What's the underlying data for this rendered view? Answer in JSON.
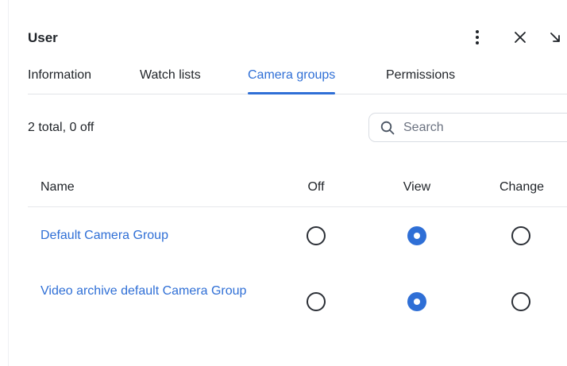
{
  "header": {
    "title": "User",
    "icons": [
      "more-vertical-icon",
      "close-icon",
      "collapse-arrow-icon"
    ]
  },
  "tabs": [
    {
      "label": "Information",
      "active": false
    },
    {
      "label": "Watch lists",
      "active": false
    },
    {
      "label": "Camera groups",
      "active": true
    },
    {
      "label": "Permissions",
      "active": false
    }
  ],
  "summary": "2 total, 0 off",
  "search": {
    "placeholder": "Search",
    "value": "",
    "icon": "search-icon"
  },
  "table": {
    "columns": [
      "Name",
      "Off",
      "View",
      "Change"
    ],
    "rows": [
      {
        "name": "Default Camera Group",
        "selected": "View"
      },
      {
        "name": "Video archive default Camera Group",
        "selected": "View"
      }
    ]
  },
  "colors": {
    "accent": "#2f6fd6",
    "text": "#1f2328",
    "divider": "#e1e4e8"
  }
}
